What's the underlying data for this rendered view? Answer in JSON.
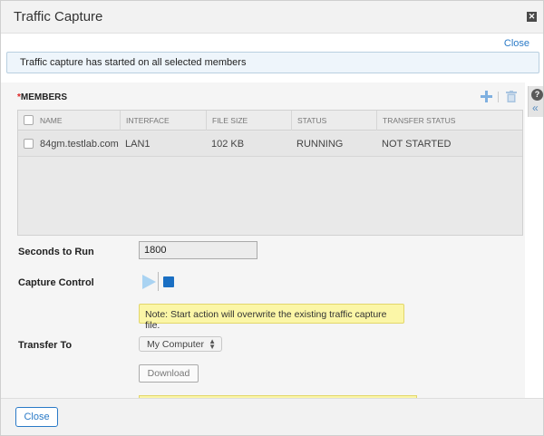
{
  "dialog": {
    "title": "Traffic Capture",
    "close_icon_glyph": "✕",
    "close_link": "Close"
  },
  "banner": {
    "message": "Traffic capture has started on all selected members"
  },
  "members": {
    "required_mark": "*",
    "label": "MEMBERS",
    "columns": [
      "NAME",
      "INTERFACE",
      "FILE SIZE",
      "STATUS",
      "TRANSFER STATUS"
    ],
    "rows": [
      {
        "name": "84gm.testlab.com",
        "interface": "LAN1",
        "file_size": "102 KB",
        "status": "RUNNING",
        "transfer_status": "NOT STARTED"
      }
    ]
  },
  "help": {
    "help_glyph": "?",
    "collapse_glyph": "«"
  },
  "form": {
    "seconds_label": "Seconds to Run",
    "seconds_value": "1800",
    "capture_label": "Capture Control",
    "note": "Note: Start action will overwrite the existing traffic capture file.",
    "transfer_label": "Transfer To",
    "transfer_value": "My Computer",
    "download_label": "Download"
  },
  "footer": {
    "close_label": "Close"
  },
  "colors": {
    "accent": "#2a7ac7",
    "stop": "#1a6fc3",
    "note_bg": "#fbf6a7",
    "required": "#dd2222"
  },
  "icons": {
    "add": "plus-icon",
    "delete": "trash-icon",
    "play": "play-icon",
    "stop": "stop-icon"
  }
}
